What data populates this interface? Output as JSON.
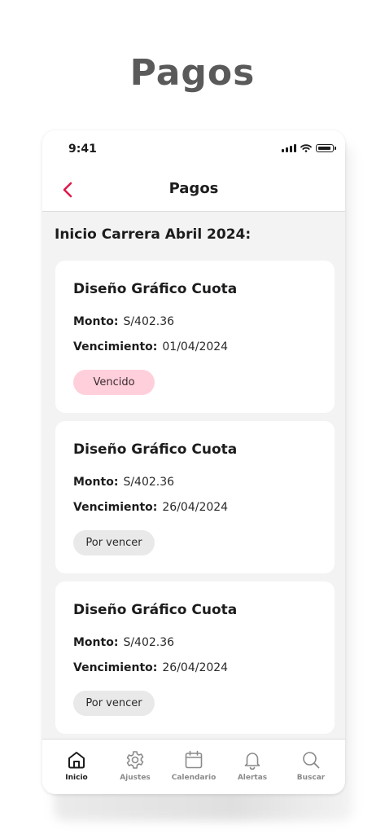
{
  "hero_title": "Pagos",
  "status_bar": {
    "time": "9:41"
  },
  "nav": {
    "title": "Pagos",
    "accent_color": "#e0194a"
  },
  "section_title": "Inicio Carrera Abril 2024:",
  "payments": [
    {
      "title": "Diseño Gráfico Cuota",
      "amount_label": "Monto:",
      "amount": "S/402.36",
      "due_label": "Vencimiento:",
      "due_date": "01/04/2024",
      "status": "Vencido",
      "status_color": "#ffd0dc"
    },
    {
      "title": "Diseño Gráfico Cuota",
      "amount_label": "Monto:",
      "amount": "S/402.36",
      "due_label": "Vencimiento:",
      "due_date": "26/04/2024",
      "status": "Por vencer",
      "status_color": "#e9e9e9"
    },
    {
      "title": "Diseño Gráfico Cuota",
      "amount_label": "Monto:",
      "amount": "S/402.36",
      "due_label": "Vencimiento:",
      "due_date": "26/04/2024",
      "status": "Por vencer",
      "status_color": "#e9e9e9"
    }
  ],
  "tabs": [
    {
      "label": "Inicio",
      "icon": "home-icon",
      "active": true
    },
    {
      "label": "Ajustes",
      "icon": "gear-icon",
      "active": false
    },
    {
      "label": "Calendario",
      "icon": "calendar-icon",
      "active": false
    },
    {
      "label": "Alertas",
      "icon": "bell-icon",
      "active": false
    },
    {
      "label": "Buscar",
      "icon": "search-icon",
      "active": false
    }
  ]
}
